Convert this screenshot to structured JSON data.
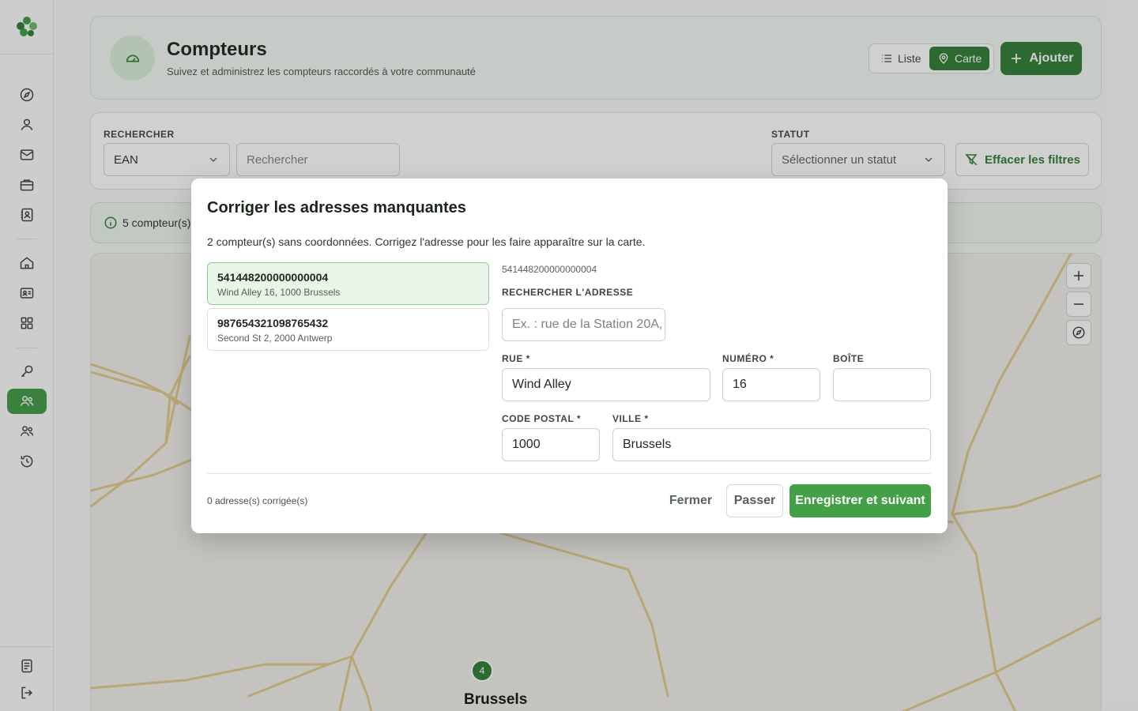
{
  "sidebar": {
    "logo_icon": "clover-logo-icon",
    "items": [
      {
        "icon": "compass-icon"
      },
      {
        "icon": "user-icon"
      },
      {
        "icon": "mail-icon"
      },
      {
        "icon": "briefcase-icon"
      },
      {
        "icon": "contact-book-icon"
      },
      {
        "icon": "home-icon"
      },
      {
        "icon": "id-card-icon"
      },
      {
        "icon": "grid-icon"
      },
      {
        "icon": "key-search-icon"
      },
      {
        "icon": "meters-icon",
        "active": true
      },
      {
        "icon": "users-icon"
      },
      {
        "icon": "history-icon"
      }
    ],
    "bottom_items": [
      {
        "icon": "document-icon"
      },
      {
        "icon": "logout-icon"
      }
    ]
  },
  "header": {
    "title": "Compteurs",
    "subtitle": "Suivez et administrez les compteurs raccordés à votre communauté",
    "view_list_label": "Liste",
    "view_map_label": "Carte",
    "add_label": "Ajouter"
  },
  "filters": {
    "search_label": "RECHERCHER",
    "search_field_value": "EAN",
    "search_placeholder": "Rechercher",
    "status_label": "STATUT",
    "status_placeholder": "Sélectionner un statut",
    "clear_label": "Effacer les filtres"
  },
  "info_bar": {
    "text": "5 compteur(s)"
  },
  "map": {
    "cluster_count": "4",
    "city_label": "Brussels",
    "road_color": "#e2c98a"
  },
  "modal": {
    "title": "Corriger les adresses manquantes",
    "description": "2 compteur(s) sans coordonnées. Corrigez l'adresse pour les faire apparaître sur la carte.",
    "meters": [
      {
        "ean": "541448200000000004",
        "address": "Wind Alley 16, 1000 Brussels"
      },
      {
        "ean": "987654321098765432",
        "address": "Second St 2, 2000 Antwerp"
      }
    ],
    "selected_ean": "541448200000000004",
    "address_search_label": "RECHERCHER L'ADRESSE",
    "address_search_placeholder": "Ex. : rue de la Station 20A,",
    "street_label": "RUE *",
    "street_value": "Wind Alley",
    "number_label": "NUMÉRO *",
    "number_value": "16",
    "box_label": "BOÎTE",
    "box_value": "",
    "postal_label": "CODE POSTAL *",
    "postal_value": "1000",
    "city_label": "VILLE *",
    "city_value": "Brussels",
    "fixed_count": "0 adresse(s) corrigée(s)",
    "close_label": "Fermer",
    "skip_label": "Passer",
    "save_label": "Enregistrer et suivant"
  },
  "colors": {
    "brand_green": "#2f7d34",
    "save_green": "#43a047"
  }
}
